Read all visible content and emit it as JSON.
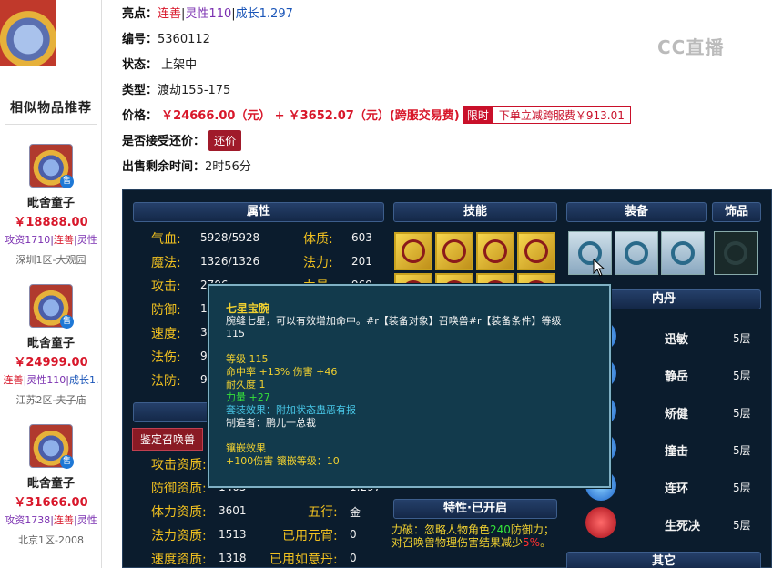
{
  "watermark": "CC直播",
  "listing": {
    "highlights_label": "亮点：",
    "highlights": [
      "连善",
      "灵性110",
      "成长1.297"
    ],
    "id_label": "编号：",
    "id": "5360112",
    "status_label": "状态：",
    "status": "上架中",
    "type_label": "类型：",
    "type": "渡劫155-175",
    "price_label": "价格：",
    "price": "￥24666.00（元）",
    "plus": "+",
    "fee": "￥3652.07（元）(跨服交易费)",
    "limited": "限时",
    "discount": "下单立减跨服费￥913.01",
    "bargain_label": "是否接受还价：",
    "bargain_button": "还价",
    "remain_label": "出售剩余时间：",
    "remain": "2时56分"
  },
  "sidebar": {
    "title": "相似物品推荐",
    "items": [
      {
        "name": "毗舍童子",
        "price": "￥18888.00",
        "tags": [
          "攻资1710",
          "连善",
          "灵性"
        ],
        "server": "深圳1区-大观园",
        "badge": "售"
      },
      {
        "name": "毗舍童子",
        "price": "￥24999.00",
        "tags": [
          "连善",
          "灵性110",
          "成长1."
        ],
        "server": "江苏2区-夫子庙",
        "badge": "售"
      },
      {
        "name": "毗舍童子",
        "price": "￥31666.00",
        "tags": [
          "攻资1738",
          "连善",
          "灵性"
        ],
        "server": "北京1区-2008",
        "badge": "售"
      }
    ]
  },
  "panel": {
    "headers": {
      "attr": "属性",
      "skills": "技能",
      "equip": "装备",
      "accessory": "饰品",
      "neidan": "内丹",
      "special": "特性·已开启",
      "other": "其它",
      "identify": "鉴定召唤兽"
    },
    "attrs_left": [
      {
        "k": "气血:",
        "v": "5928/5928"
      },
      {
        "k": "魔法:",
        "v": "1326/1326"
      },
      {
        "k": "攻击:",
        "v": "2706"
      },
      {
        "k": "防御:",
        "v": "1"
      },
      {
        "k": "速度:",
        "v": "3"
      },
      {
        "k": "法伤:",
        "v": "9"
      },
      {
        "k": "法防:",
        "v": "9"
      }
    ],
    "attrs_right": [
      {
        "k": "体质:",
        "v": "603"
      },
      {
        "k": "法力:",
        "v": "201"
      },
      {
        "k": "力量:",
        "v": "969"
      }
    ],
    "aptitudes": [
      {
        "k": "攻击资质:",
        "v": ""
      },
      {
        "k": "防御资质:",
        "v": "1405"
      },
      {
        "k": "体力资质:",
        "v": "3601"
      },
      {
        "k": "法力资质:",
        "v": "1513"
      },
      {
        "k": "速度资质:",
        "v": "1318"
      }
    ],
    "aptitudes_right": [
      {
        "k": "",
        "v": "1.297"
      },
      {
        "k": "五行:",
        "v": "金"
      },
      {
        "k": "已用元宵:",
        "v": "0"
      },
      {
        "k": "已用如意丹:",
        "v": "0"
      }
    ],
    "neidan": [
      {
        "name": "迅敏",
        "level": "5层"
      },
      {
        "name": "静岳",
        "level": "5层"
      },
      {
        "name": "矫健",
        "level": "5层"
      },
      {
        "name": "撞击",
        "level": "5层"
      },
      {
        "name": "连环",
        "level": "5层"
      },
      {
        "name": "生死决",
        "level": "5层"
      }
    ],
    "special_text": [
      "力破：忽略人物角色",
      "240",
      "防御力；",
      "对召唤兽物理伤害结果减少",
      "5%",
      "。"
    ]
  },
  "tooltip": {
    "title": "七星宝腕",
    "desc": "腕缝七星，可以有效增加命中。#r【装备对象】召唤兽#r【装备条件】等级",
    "desc2": "115",
    "lines": [
      {
        "t": "等级 115",
        "c": "y"
      },
      {
        "t": "命中率 +13% 伤害 +46",
        "c": "y"
      },
      {
        "t": "耐久度 1",
        "c": "y"
      },
      {
        "t": "力量 +27",
        "c": "g"
      },
      {
        "t": "套装效果：附加状态蛊恶有报",
        "c": "c"
      },
      {
        "t": "制造者：鹏儿一总裁",
        "c": "w"
      },
      {
        "t": "",
        "c": "w"
      },
      {
        "t": "镶嵌效果",
        "c": "y"
      },
      {
        "t": "+100伤害 镶嵌等级：10",
        "c": "y"
      }
    ]
  },
  "colors": {
    "price": "#d8172a",
    "panel_bg": "#0b1c2d",
    "gold": "#f0c020"
  }
}
